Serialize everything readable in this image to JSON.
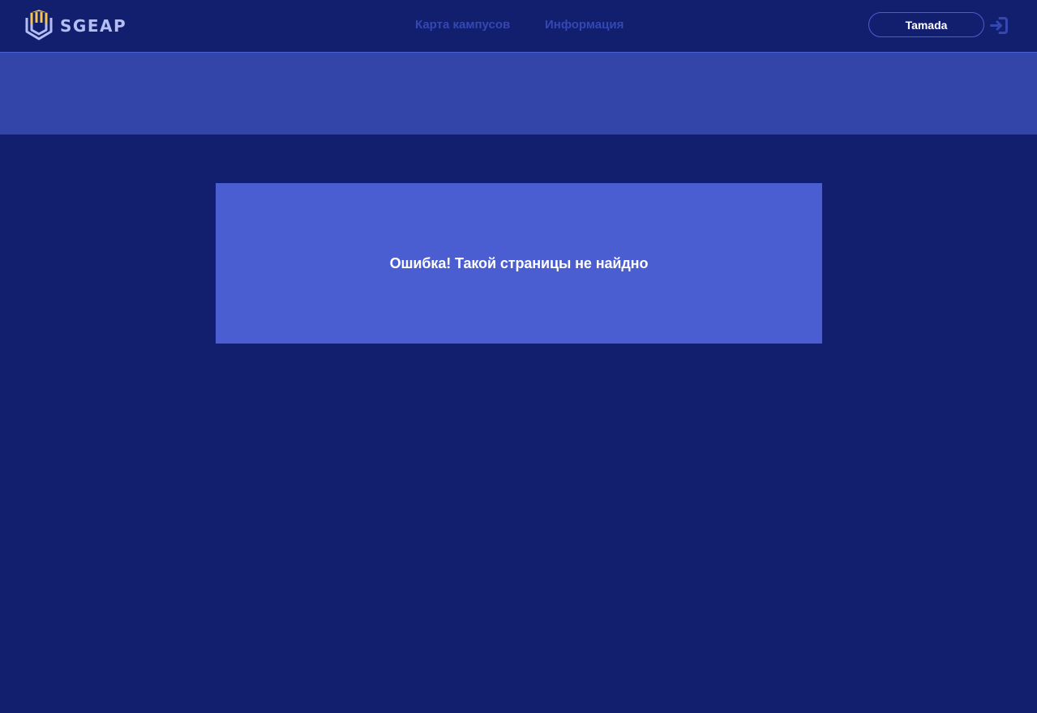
{
  "header": {
    "brand": "SGEAP",
    "logo_icon": "shield-columns-logo-icon",
    "nav": [
      {
        "label": "Карта кампусов"
      },
      {
        "label": "Информация"
      }
    ],
    "user_button": "Tamada",
    "logout_icon": "logout-arrow-icon"
  },
  "error": {
    "message": "Ошибка! Такой страницы не найдно"
  },
  "colors": {
    "background": "#121f6e",
    "banner": "#3445aa",
    "card": "#4a5dd1",
    "nav_text": "#3447b3",
    "brand_text": "#b4bdf4",
    "logo_accent": "#f5c451"
  }
}
